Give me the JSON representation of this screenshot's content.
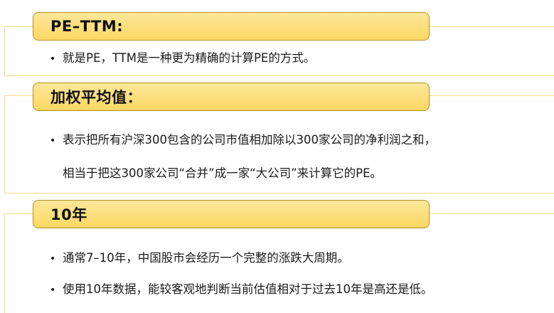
{
  "sections": [
    {
      "title": "PE–TTM:",
      "bullets": [
        "就是PE，TTM是一种更为精确的计算PE的方式。"
      ]
    },
    {
      "title": "加权平均值：",
      "bullets": [
        "表示把所有沪深300包含的公司市值相加除以300家公司的净利润之和，"
      ],
      "continuation": "相当于把这300家公司“合并”成一家“大公司”来计算它的PE。"
    },
    {
      "title": "10年",
      "bullets": [
        "通常7–10年，中国股市会经历一个完整的涨跌大周期。",
        "使用10年数据，能较客观地判断当前估值相对于过去10年是高还是低。"
      ]
    }
  ],
  "colors": {
    "header_fill": "#fbd863",
    "header_border": "#b48d1f",
    "frame_line": "#f3d98a"
  }
}
